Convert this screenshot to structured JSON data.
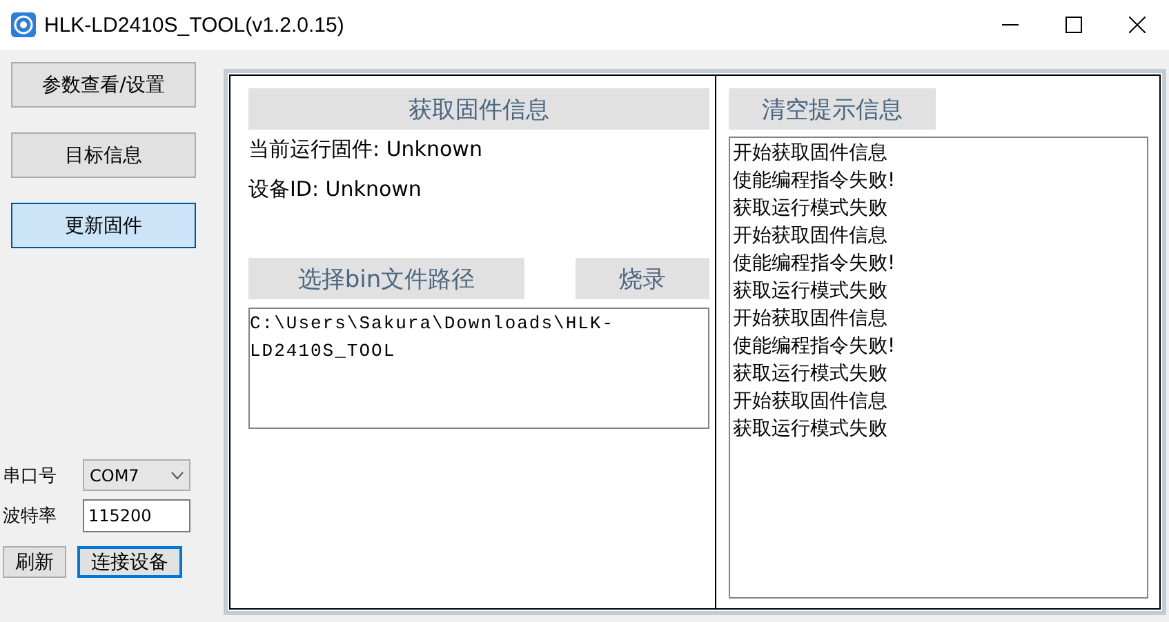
{
  "window": {
    "title": "HLK-LD2410S_TOOL(v1.2.0.15)"
  },
  "nav": [
    {
      "label": "参数查看/设置",
      "selected": false
    },
    {
      "label": "目标信息",
      "selected": false
    },
    {
      "label": "更新固件",
      "selected": true
    }
  ],
  "serial": {
    "port_label": "串口号",
    "port": "COM7",
    "baud_label": "波特率",
    "baud": "115200",
    "refresh": "刷新",
    "connect": "连接设备"
  },
  "firmware": {
    "get_button": "获取固件信息",
    "current_label": "当前运行固件: Unknown",
    "device_label": "设备ID: Unknown",
    "select_button": "选择bin文件路径",
    "flash_button": "烧录",
    "path": "C:\\Users\\Sakura\\Downloads\\HLK-LD2410S_TOOL"
  },
  "log": {
    "clear_button": "清空提示信息",
    "lines": [
      "开始获取固件信息",
      "使能编程指令失败!",
      "获取运行模式失败",
      "开始获取固件信息",
      "使能编程指令失败!",
      "获取运行模式失败",
      "开始获取固件信息",
      "使能编程指令失败!",
      "获取运行模式失败",
      "开始获取固件信息",
      "获取运行模式失败"
    ]
  }
}
